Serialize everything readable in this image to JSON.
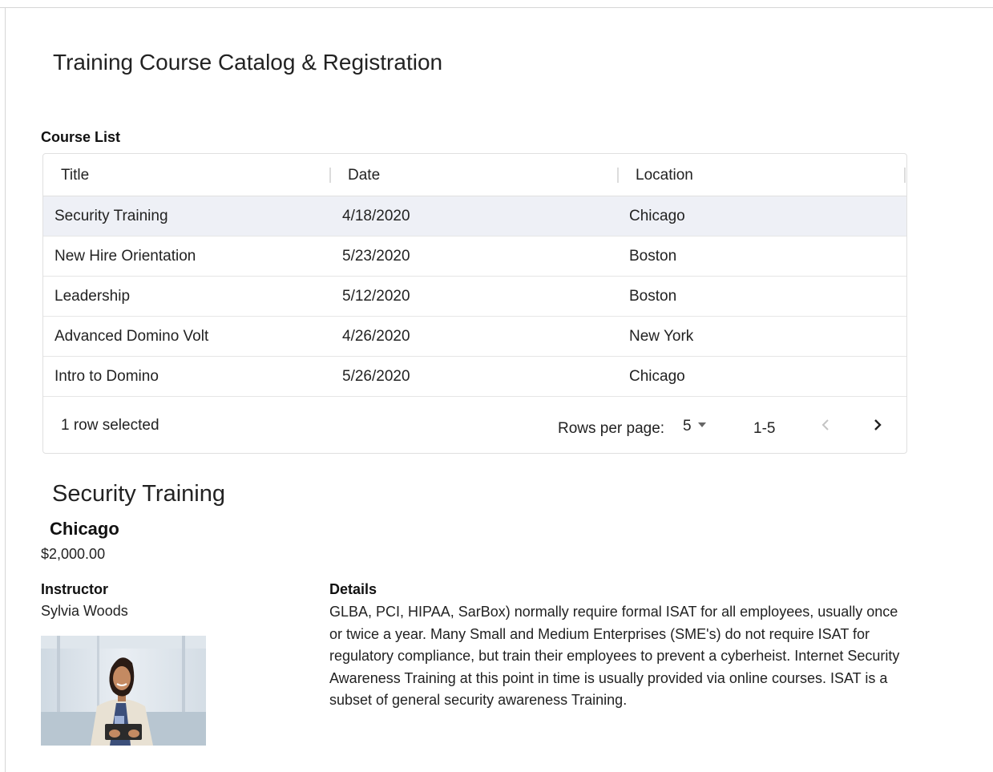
{
  "page": {
    "title": "Training Course Catalog & Registration"
  },
  "course_list": {
    "label": "Course List",
    "columns": [
      "Title",
      "Date",
      "Location"
    ],
    "rows": [
      {
        "title": "Security Training",
        "date": "4/18/2020",
        "location": "Chicago",
        "selected": true
      },
      {
        "title": "New Hire Orientation",
        "date": "5/23/2020",
        "location": "Boston",
        "selected": false
      },
      {
        "title": "Leadership",
        "date": "5/12/2020",
        "location": "Boston",
        "selected": false
      },
      {
        "title": "Advanced Domino Volt",
        "date": "4/26/2020",
        "location": "New York",
        "selected": false
      },
      {
        "title": "Intro to Domino",
        "date": "5/26/2020",
        "location": "Chicago",
        "selected": false
      }
    ],
    "footer": {
      "selected_text": "1 row selected",
      "rows_per_page_label": "Rows per page:",
      "rows_per_page_value": "5",
      "range": "1-5"
    }
  },
  "detail": {
    "title": "Security Training",
    "location": "Chicago",
    "price": "$2,000.00",
    "instructor_label": "Instructor",
    "instructor_name": "Sylvia Woods",
    "details_label": "Details",
    "details_text": "GLBA, PCI, HIPAA, SarBox) normally require formal ISAT for all employees, usually once or twice a year. Many Small and Medium Enterprises (SME's) do not require ISAT for regulatory compliance, but train their employees to prevent a cyberheist. Internet Security Awareness Training at this point in time is usually provided via online courses. ISAT is a subset of general security awareness Training."
  },
  "icons": {
    "prev": "chevron-left-icon",
    "next": "chevron-right-icon",
    "dropdown": "caret-down-icon"
  },
  "colors": {
    "selected_row": "#eef0f6",
    "border": "#e0e0e0"
  }
}
